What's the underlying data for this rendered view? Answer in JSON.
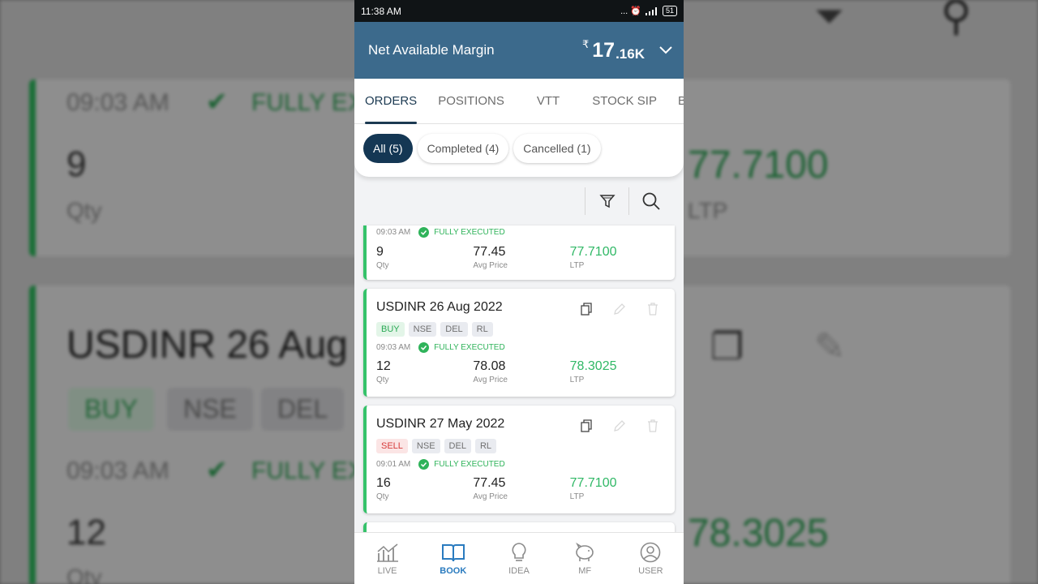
{
  "status_bar": {
    "time": "11:38 AM",
    "icons": "... ⏰ ",
    "battery": "51"
  },
  "header": {
    "title": "Net Available Margin",
    "currency": "₹",
    "value": "17",
    "unit": ".16K"
  },
  "tabs": [
    {
      "label": "ORDERS",
      "active": true
    },
    {
      "label": "POSITIONS"
    },
    {
      "label": "VTT"
    },
    {
      "label": "STOCK SIP"
    },
    {
      "label": "BA"
    }
  ],
  "filters": [
    {
      "label": "All (5)",
      "active": true
    },
    {
      "label": "Completed (4)"
    },
    {
      "label": "Cancelled (1)"
    }
  ],
  "orders": [
    {
      "title": "",
      "time": "09:03 AM",
      "status": "FULLY EXECUTED",
      "qty": "9",
      "qty_label": "Qty",
      "avg": "77.45",
      "avg_label": "Avg Price",
      "ltp": "77.7100",
      "ltp_label": "LTP"
    },
    {
      "title": "USDINR 26 Aug 2022",
      "side": "BUY",
      "tags": [
        "NSE",
        "DEL",
        "RL"
      ],
      "time": "09:03 AM",
      "status": "FULLY EXECUTED",
      "qty": "12",
      "qty_label": "Qty",
      "avg": "78.08",
      "avg_label": "Avg Price",
      "ltp": "78.3025",
      "ltp_label": "LTP"
    },
    {
      "title": "USDINR 27 May 2022",
      "side": "SELL",
      "tags": [
        "NSE",
        "DEL",
        "RL"
      ],
      "time": "09:01 AM",
      "status": "FULLY EXECUTED",
      "qty": "16",
      "qty_label": "Qty",
      "avg": "77.45",
      "avg_label": "Avg Price",
      "ltp": "77.7100",
      "ltp_label": "LTP"
    }
  ],
  "nav": [
    {
      "label": "LIVE",
      "icon": "chart-icon"
    },
    {
      "label": "BOOK",
      "icon": "book-icon",
      "active": true
    },
    {
      "label": "IDEA",
      "icon": "bulb-icon"
    },
    {
      "label": "MF",
      "icon": "piggy-bank-icon"
    },
    {
      "label": "USER",
      "icon": "user-icon"
    }
  ],
  "background": {
    "time": "09:03 AM",
    "status": "FULLY EX",
    "qty": "9",
    "qty_label": "Qty",
    "ltp_a": "77.7100",
    "ltp_label": "LTP",
    "title": "USDINR 26 Aug",
    "side": "BUY",
    "ex": "NSE",
    "del": "DEL",
    "status_b": "FULLY EXE",
    "qty_b": "12",
    "qty_label_b": "Qty",
    "ltp_b": "78.3025"
  },
  "colors": {
    "header": "#3c6a8c",
    "accent": "#143754",
    "green": "#30b866",
    "sell": "#d63b3b"
  }
}
